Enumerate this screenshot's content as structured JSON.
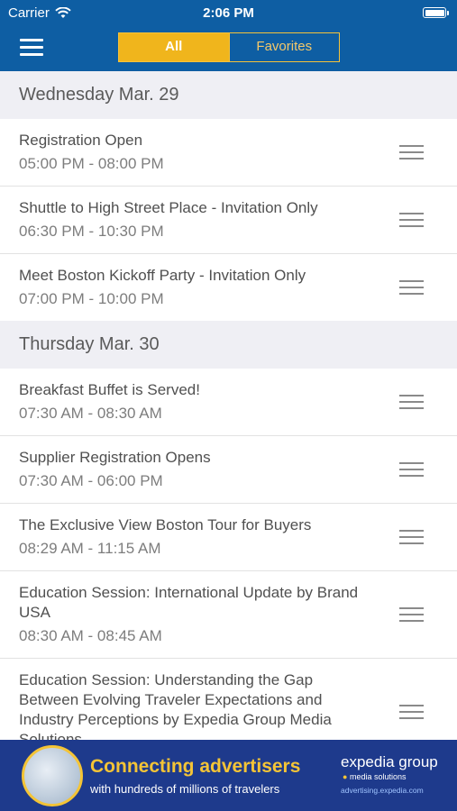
{
  "status_bar": {
    "carrier": "Carrier",
    "time": "2:06 PM"
  },
  "nav": {
    "segments": [
      {
        "label": "All",
        "selected": true
      },
      {
        "label": "Favorites",
        "selected": false
      }
    ]
  },
  "days": [
    {
      "label": "Wednesday Mar. 29",
      "events": [
        {
          "title": "Registration Open",
          "time": "05:00 PM - 08:00 PM"
        },
        {
          "title": "Shuttle to High Street Place - Invitation Only",
          "time": "06:30 PM - 10:30 PM"
        },
        {
          "title": "Meet Boston Kickoff Party - Invitation Only",
          "time": "07:00 PM - 10:00 PM"
        }
      ]
    },
    {
      "label": "Thursday Mar. 30",
      "events": [
        {
          "title": "Breakfast Buffet is Served!",
          "time": "07:30 AM - 08:30 AM"
        },
        {
          "title": "Supplier Registration Opens",
          "time": "07:30 AM - 06:00 PM"
        },
        {
          "title": "The Exclusive View Boston Tour for Buyers",
          "time": "08:29 AM - 11:15 AM"
        },
        {
          "title": "Education Session: International Update by Brand USA",
          "time": "08:30 AM - 08:45 AM"
        },
        {
          "title": "Education Session: Understanding the Gap Between Evolving Traveler Expectations and Industry Perceptions by Expedia Group Media Solutions",
          "time": ""
        }
      ]
    }
  ],
  "ad": {
    "headline": "Connecting advertisers",
    "subline": "with hundreds of millions of travelers",
    "brand": "expedia group",
    "brand_sub": "media solutions",
    "url": "advertising.expedia.com"
  }
}
